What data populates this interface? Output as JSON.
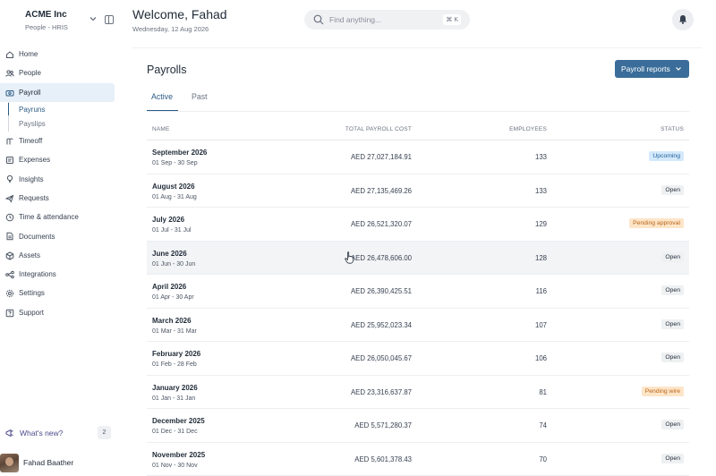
{
  "org": {
    "name": "ACME Inc",
    "subtitle": "People - HRIS"
  },
  "nav": {
    "items": [
      {
        "label": "Home",
        "icon": "home-icon"
      },
      {
        "label": "People",
        "icon": "people-icon"
      },
      {
        "label": "Payroll",
        "icon": "payroll-icon",
        "active": true
      },
      {
        "label": "Timeoff",
        "icon": "timeoff-icon"
      },
      {
        "label": "Expenses",
        "icon": "expenses-icon"
      },
      {
        "label": "Insights",
        "icon": "insights-icon"
      },
      {
        "label": "Requests",
        "icon": "requests-icon"
      },
      {
        "label": "Time & attendance",
        "icon": "clock-icon"
      },
      {
        "label": "Documents",
        "icon": "documents-icon"
      },
      {
        "label": "Assets",
        "icon": "assets-icon"
      },
      {
        "label": "Integrations",
        "icon": "integrations-icon"
      },
      {
        "label": "Settings",
        "icon": "gear-icon"
      },
      {
        "label": "Support",
        "icon": "support-icon"
      }
    ],
    "payroll_sub": [
      {
        "label": "Payruns",
        "active": true
      },
      {
        "label": "Payslips"
      }
    ]
  },
  "footer": {
    "whats_new": "What's new?",
    "whats_new_count": "2",
    "user_name": "Fahad Baather"
  },
  "header": {
    "welcome": "Welcome, Fahad",
    "date": "Wednesday, 12 Aug 2026",
    "search_placeholder": "Find anything...",
    "search_shortcut": "⌘ K"
  },
  "main": {
    "title": "Payrolls",
    "reports_button": "Payroll reports",
    "tabs": [
      {
        "label": "Active",
        "active": true
      },
      {
        "label": "Past"
      }
    ],
    "columns": {
      "name": "NAME",
      "cost": "TOTAL PAYROLL COST",
      "employees": "EMPLOYEES",
      "status": "STATUS"
    },
    "rows": [
      {
        "period": "September 2026",
        "range": "01 Sep - 30 Sep",
        "cost": "AED 27,027,184.91",
        "employees": "133",
        "status": "Upcoming"
      },
      {
        "period": "August 2026",
        "range": "01 Aug - 31 Aug",
        "cost": "AED 27,135,469.26",
        "employees": "133",
        "status": "Open"
      },
      {
        "period": "July 2026",
        "range": "01 Jul - 31 Jul",
        "cost": "AED 26,521,320.07",
        "employees": "129",
        "status": "Pending approval"
      },
      {
        "period": "June 2026",
        "range": "01 Jun - 30 Jun",
        "cost": "AED 26,478,606.00",
        "employees": "128",
        "status": "Open",
        "hover": true
      },
      {
        "period": "April 2026",
        "range": "01 Apr - 30 Apr",
        "cost": "AED 26,390,425.51",
        "employees": "116",
        "status": "Open"
      },
      {
        "period": "March 2026",
        "range": "01 Mar - 31 Mar",
        "cost": "AED 25,952,023.34",
        "employees": "107",
        "status": "Open"
      },
      {
        "period": "February 2026",
        "range": "01 Feb - 28 Feb",
        "cost": "AED 26,050,045.67",
        "employees": "106",
        "status": "Open"
      },
      {
        "period": "January 2026",
        "range": "01 Jan - 31 Jan",
        "cost": "AED 23,316,637.87",
        "employees": "81",
        "status": "Pending wire"
      },
      {
        "period": "December 2025",
        "range": "01 Dec - 31 Dec",
        "cost": "AED 5,571,280.37",
        "employees": "74",
        "status": "Open"
      },
      {
        "period": "November 2025",
        "range": "01 Nov - 30 Nov",
        "cost": "AED 5,601,378.43",
        "employees": "70",
        "status": "Open"
      }
    ]
  },
  "status_colors": {
    "Upcoming": {
      "bg": "#d4e9fb",
      "fg": "#1e5f99"
    },
    "Open": {
      "bg": "#eef0f2",
      "fg": "#1f2a37"
    },
    "Pending approval": {
      "bg": "#fde5c8",
      "fg": "#b9651a"
    },
    "Pending wire": {
      "bg": "#fde5c8",
      "fg": "#b9651a"
    }
  },
  "colors": {
    "accent": "#2b5a84",
    "button": "#3a6d99",
    "active_nav_bg": "#e7f0f9"
  }
}
